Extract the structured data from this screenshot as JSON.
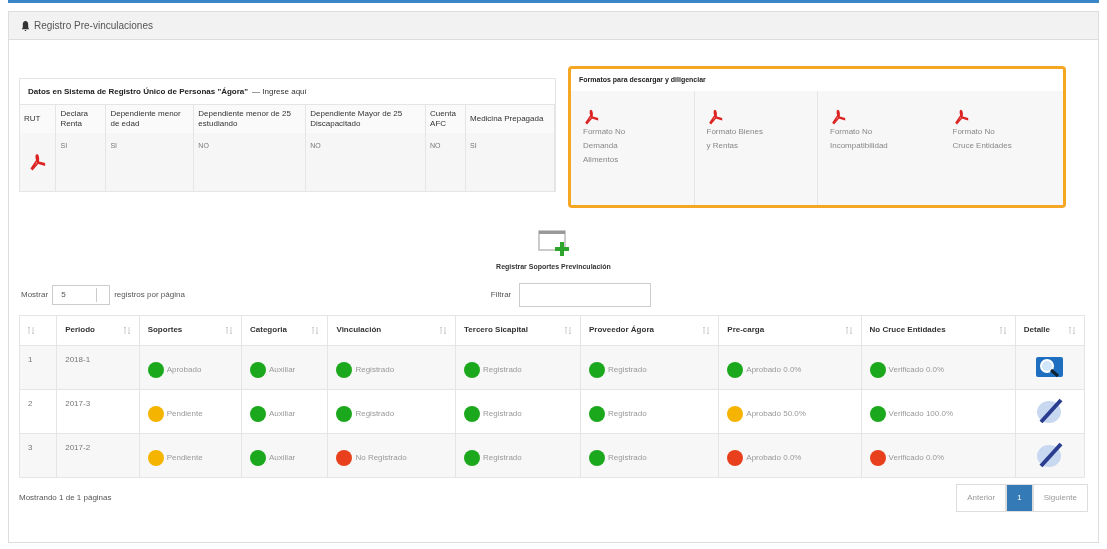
{
  "panel": {
    "title": "Registro Pre-vinculaciones"
  },
  "agora": {
    "title": "Datos en Sistema de Registro Único de Personas \"Ágora\"",
    "link": "— Ingrese aquí",
    "columns": [
      "RUT",
      "Declara Renta",
      "Dependiente menor de edad",
      "Dependiente menor de 25 estudiando",
      "Dependiente Mayor de 25 Discapacitado",
      "Cuenta AFC",
      "Medicina Prepagada"
    ],
    "values": [
      "SI",
      "SI",
      "NO",
      "NO",
      "NO",
      "SI"
    ]
  },
  "formatos": {
    "title": "Formatos para descargar y diligenciar",
    "items": [
      {
        "words": [
          "Formato",
          "No",
          "Demanda",
          "Alimentos"
        ]
      },
      {
        "words": [
          "Formato",
          "Bienes",
          "y",
          "Rentas"
        ]
      },
      {
        "words": [
          "Formato",
          "No",
          "Incompatibilidad"
        ]
      },
      {
        "words": [
          "Formato",
          "No",
          "Cruce",
          "Entidades"
        ]
      }
    ]
  },
  "register": {
    "label": "Registrar Soportes Previnculación"
  },
  "length": {
    "before": "Mostrar",
    "value": "5",
    "after": "registros por página"
  },
  "filter": {
    "label": "Filtrar"
  },
  "table": {
    "columns": [
      "",
      "Periodo",
      "Soportes",
      "Categoria",
      "Vinculación",
      "Tercero Sicapital",
      "Proveedor Ágora",
      "Pre-carga",
      "No Cruce Entidades",
      "Detalle"
    ],
    "rows": [
      {
        "cells": [
          {
            "kind": "text",
            "text": "1"
          },
          {
            "kind": "text",
            "text": "2018-1"
          },
          {
            "kind": "status",
            "text": "Aprobado",
            "color": "#1ca81c"
          },
          {
            "kind": "status",
            "text": "Auxiliar",
            "color": "#1ca81c"
          },
          {
            "kind": "status",
            "text": "Registrado",
            "color": "#1ca81c"
          },
          {
            "kind": "status",
            "text": "Registrado",
            "color": "#1ca81c"
          },
          {
            "kind": "status",
            "text": "Registrado",
            "color": "#1ca81c"
          },
          {
            "kind": "status",
            "text": "Aprobado 0.0%",
            "color": "#1ca81c"
          },
          {
            "kind": "status",
            "text": "Verificado 0.0%",
            "color": "#1ca81c"
          },
          {
            "kind": "view"
          }
        ]
      },
      {
        "cells": [
          {
            "kind": "text",
            "text": "2"
          },
          {
            "kind": "text",
            "text": "2017-3"
          },
          {
            "kind": "status",
            "text": "Pendiente",
            "color": "#f5b400"
          },
          {
            "kind": "status",
            "text": "Auxiliar",
            "color": "#1ca81c"
          },
          {
            "kind": "status",
            "text": "Registrado",
            "color": "#1ca81c"
          },
          {
            "kind": "status",
            "text": "Registrado",
            "color": "#1ca81c"
          },
          {
            "kind": "status",
            "text": "Registrado",
            "color": "#1ca81c"
          },
          {
            "kind": "status",
            "text": "Aprobado 50.0%",
            "color": "#f5b400"
          },
          {
            "kind": "status",
            "text": "Verificado 100.0%",
            "color": "#1ca81c"
          },
          {
            "kind": "edit"
          }
        ]
      },
      {
        "cells": [
          {
            "kind": "text",
            "text": "3"
          },
          {
            "kind": "text",
            "text": "2017-2"
          },
          {
            "kind": "status",
            "text": "Pendiente",
            "color": "#f5b400"
          },
          {
            "kind": "status",
            "text": "Auxiliar",
            "color": "#1ca81c"
          },
          {
            "kind": "status",
            "text": "No Registrado",
            "color": "#e8401c"
          },
          {
            "kind": "status",
            "text": "Registrado",
            "color": "#1ca81c"
          },
          {
            "kind": "status",
            "text": "Registrado",
            "color": "#1ca81c"
          },
          {
            "kind": "status",
            "text": "Aprobado 0.0%",
            "color": "#e8401c"
          },
          {
            "kind": "status",
            "text": "Verificado 0.0%",
            "color": "#e8401c"
          },
          {
            "kind": "edit"
          }
        ]
      }
    ]
  },
  "info": "Mostrando 1 de 1 páginas",
  "pagination": [
    {
      "label": "Anterior",
      "selected": false
    },
    {
      "label": "1",
      "selected": true
    },
    {
      "label": "Siguiente",
      "selected": false
    }
  ]
}
